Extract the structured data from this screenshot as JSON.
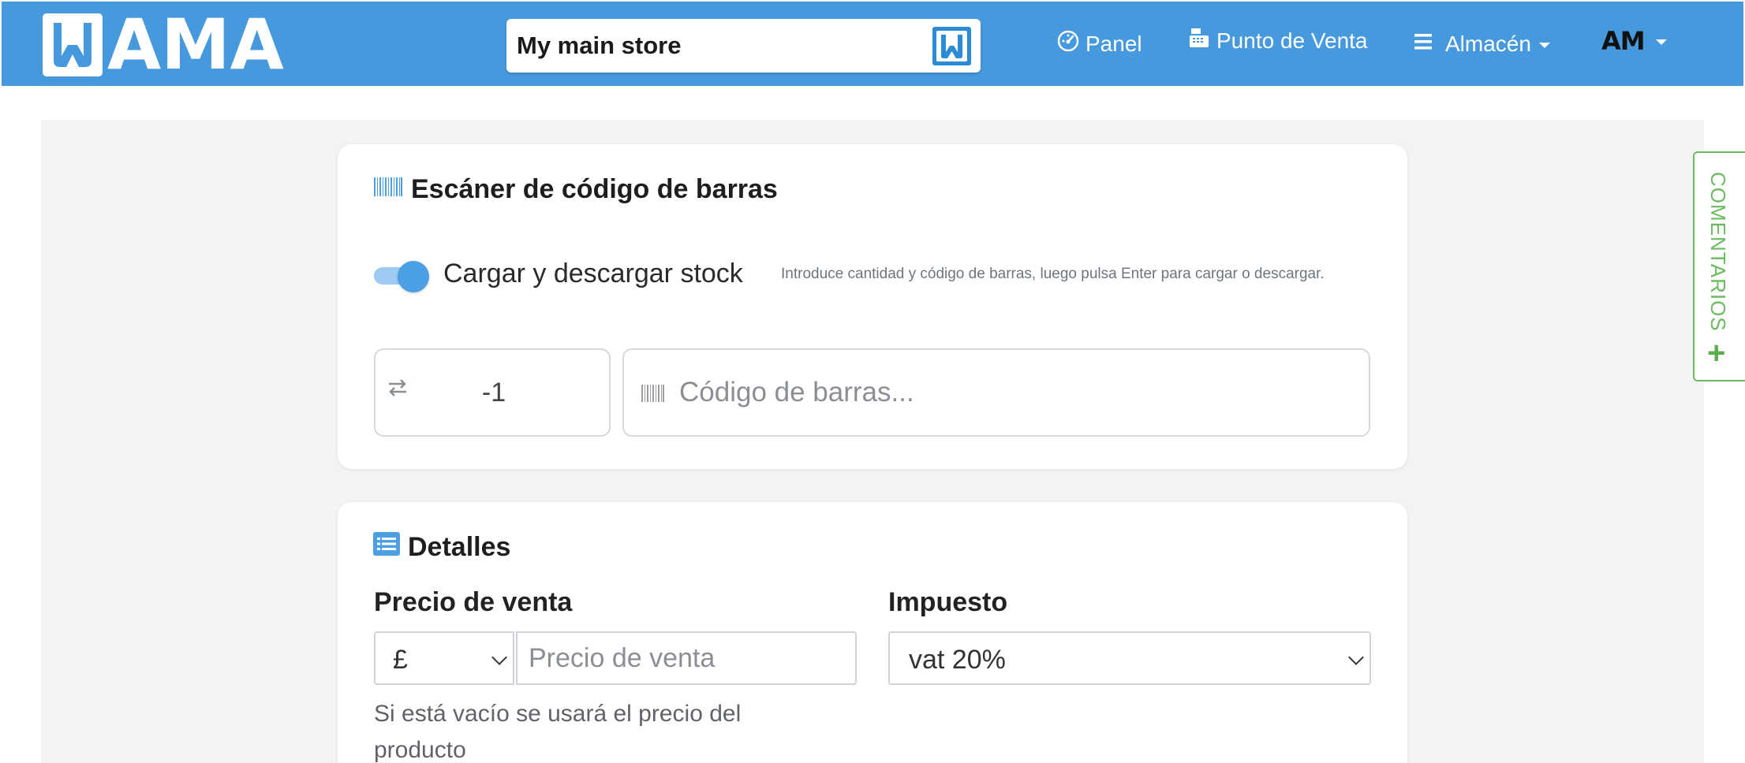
{
  "brand": {
    "logo_text": "AMA",
    "primary_color": "#4599dc",
    "accent_color": "#4a9fe5",
    "comments_color": "#6dbb61"
  },
  "navbar": {
    "store_name": "My main store",
    "items": [
      {
        "label": "Panel",
        "icon": "dashboard-gauge-icon"
      },
      {
        "label": "Punto de Venta",
        "icon": "cash-register-icon"
      },
      {
        "label": "Almacén",
        "icon": "menu-lines-icon"
      }
    ],
    "user_logo": "AM"
  },
  "scanner": {
    "title": "Escáner de código de barras",
    "title_icon": "barcode-icon",
    "toggle_label": "Cargar y descargar stock",
    "toggle_on": true,
    "help": "Introduce cantidad y código de barras, luego pulsa Enter para cargar o descargar.",
    "quantity_value": "-1",
    "quantity_icon": "swap-arrows-icon",
    "barcode_placeholder": "Código de barras..."
  },
  "details": {
    "title": "Detalles",
    "title_icon": "list-icon",
    "price_label": "Precio de venta",
    "currency_value": "£",
    "price_placeholder": "Precio de venta",
    "price_help": "Si está vacío se usará el precio del producto",
    "tax_label": "Impuesto",
    "tax_value": "vat 20%"
  },
  "comments_tab": {
    "label": "COMENTARIOS",
    "icon": "plus-icon"
  }
}
